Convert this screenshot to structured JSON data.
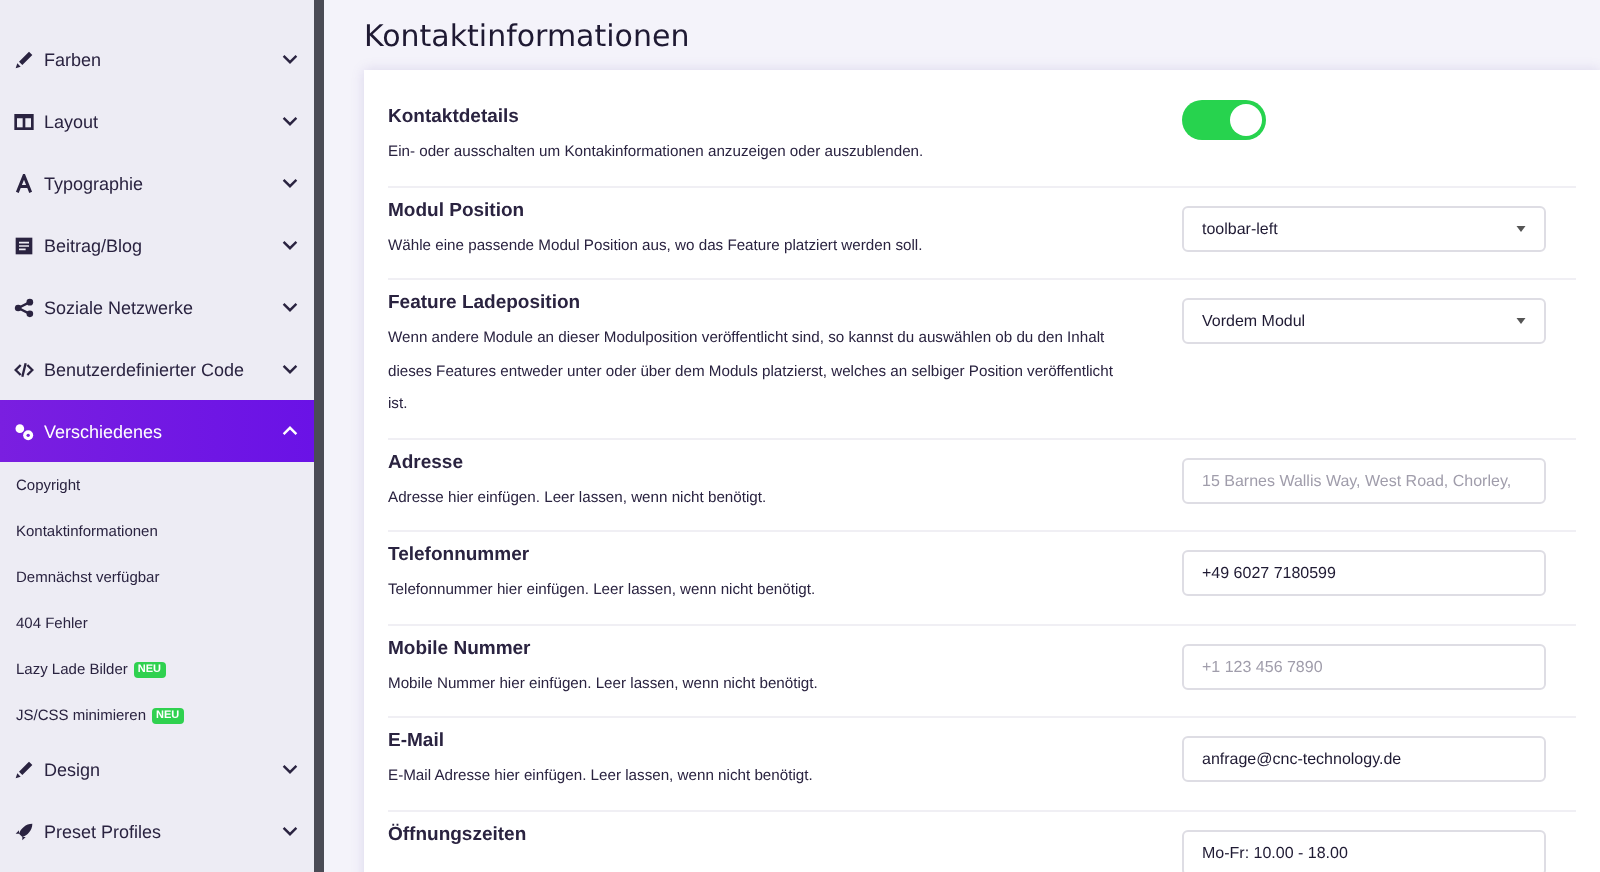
{
  "sidebar": {
    "items": [
      {
        "label": "Farben",
        "expanded": false,
        "selected": false
      },
      {
        "label": "Layout",
        "expanded": false,
        "selected": false
      },
      {
        "label": "Typographie",
        "expanded": false,
        "selected": false
      },
      {
        "label": "Beitrag/Blog",
        "expanded": false,
        "selected": false
      },
      {
        "label": "Soziale Netzwerke",
        "expanded": false,
        "selected": false
      },
      {
        "label": "Benutzerdefinierter Code",
        "expanded": false,
        "selected": false
      },
      {
        "label": "Verschiedenes",
        "expanded": true,
        "selected": true,
        "children": [
          {
            "label": "Copyright"
          },
          {
            "label": "Kontaktinformationen"
          },
          {
            "label": "Demnächst verfügbar"
          },
          {
            "label": "404 Fehler"
          },
          {
            "label": "Lazy Lade Bilder",
            "badge": "NEU"
          },
          {
            "label": "JS/CSS minimieren",
            "badge": "NEU"
          }
        ]
      },
      {
        "label": "Design",
        "expanded": false,
        "selected": false
      },
      {
        "label": "Preset Profiles",
        "expanded": false,
        "selected": false
      }
    ]
  },
  "page": {
    "title": "Kontaktinformationen",
    "settings": [
      {
        "kind": "toggle",
        "label": "Kontaktdetails",
        "description": "Ein- oder ausschalten um Kontakinformationen anzuzeigen oder auszublenden.",
        "on": true
      },
      {
        "kind": "select",
        "label": "Modul Position",
        "description": "Wähle eine passende Modul Position aus, wo das Feature platziert werden soll.",
        "value": "toolbar-left"
      },
      {
        "kind": "select",
        "label": "Feature Ladeposition",
        "description": "Wenn andere Module an dieser Modulposition veröffentlicht sind, so kannst du auswählen ob du den Inhalt dieses Features entweder unter oder über dem Moduls platzierst, welches an selbiger Position veröffentlicht ist.",
        "value": "Vordem Modul"
      },
      {
        "kind": "input",
        "label": "Adresse",
        "description": "Adresse hier einfügen. Leer lassen, wenn nicht benötigt.",
        "placeholder": "15 Barnes Wallis Way, West Road, Chorley,"
      },
      {
        "kind": "input",
        "label": "Telefonnummer",
        "description": "Telefonnummer hier einfügen. Leer lassen, wenn nicht benötigt.",
        "value": "+49 6027 7180599"
      },
      {
        "kind": "input",
        "label": "Mobile Nummer",
        "description": "Mobile Nummer hier einfügen. Leer lassen, wenn nicht benötigt.",
        "placeholder": "+1 123 456 7890"
      },
      {
        "kind": "input",
        "label": "E-Mail",
        "description": "E-Mail Adresse hier einfügen. Leer lassen, wenn nicht benötigt.",
        "value": "anfrage@cnc-technology.de"
      },
      {
        "kind": "input",
        "label": "Öffnungszeiten",
        "value": "Mo-Fr: 10.00 - 18.00"
      }
    ]
  }
}
